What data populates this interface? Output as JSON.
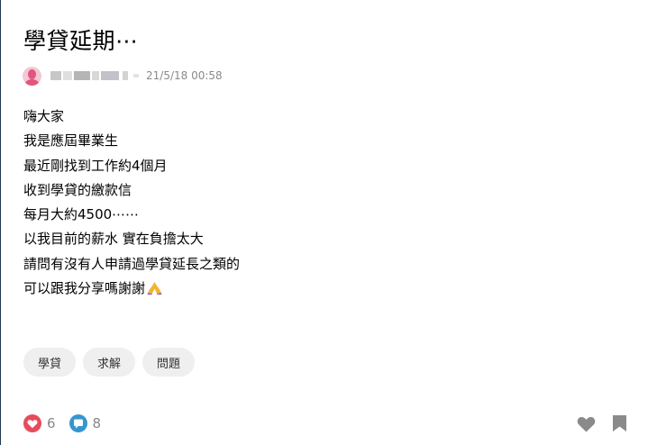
{
  "post": {
    "title": "學貸延期⋯",
    "author": "",
    "timestamp": "21/5/18 00:58",
    "lines": [
      "嗨大家",
      "我是應屆畢業生",
      "最近剛找到工作約4個月",
      "收到學貸的繳款信",
      "每月大約4500⋯⋯",
      "以我目前的薪水 實在負擔太大",
      "請問有沒有人申請過學貸延長之類的",
      "可以跟我分享嗎謝謝"
    ],
    "tags": [
      "學貸",
      "求解",
      "問題"
    ]
  },
  "stats": {
    "reactions": "6",
    "comments": "8"
  },
  "icons": {
    "avatar": "female-avatar-icon",
    "emoji": "pray-hands-icon",
    "reaction": "heart-reaction-icon",
    "comment": "comment-bubble-icon",
    "like": "heart-icon",
    "bookmark": "bookmark-icon"
  },
  "colors": {
    "reaction_red": "#e74c5b",
    "comment_blue": "#3397cf",
    "muted": "#888888",
    "tag_bg": "#efefef",
    "icon_gray": "#8a8a8a"
  }
}
